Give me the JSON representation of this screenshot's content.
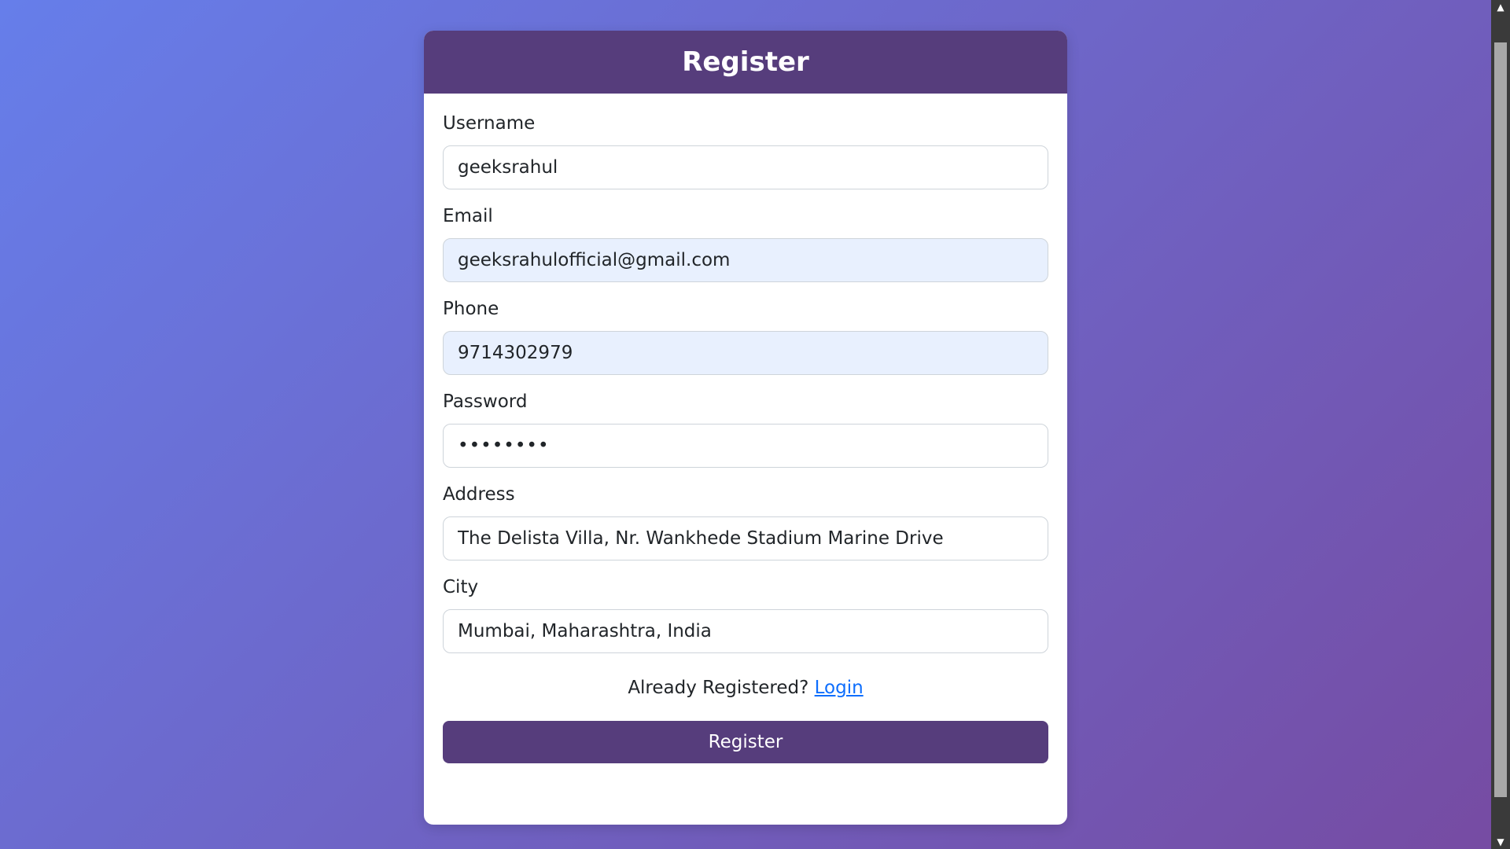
{
  "header": {
    "title": "Register"
  },
  "fields": [
    {
      "label": "Username",
      "value": "geeksrahul",
      "type": "text"
    },
    {
      "label": "Email",
      "value": "geeksrahulofficial@gmail.com",
      "type": "email"
    },
    {
      "label": "Phone",
      "value": "9714302979",
      "type": "tel"
    },
    {
      "label": "Password",
      "value": "••••••••",
      "type": "password"
    },
    {
      "label": "Address",
      "value": "The Delista Villa, Nr. Wankhede Stadium Marine Drive",
      "type": "text"
    },
    {
      "label": "City",
      "value": "Mumbai, Maharashtra, India",
      "type": "text"
    }
  ],
  "login_prompt": {
    "text": "Already Registered?",
    "link": "Login"
  },
  "submit_label": "Register",
  "icons": {
    "scroll_up": "triangle-up-icon",
    "scroll_down": "triangle-down-icon"
  },
  "colors": {
    "header_bg": "#563d7c",
    "button_bg": "#563d7c",
    "link": "#0d6efd",
    "autofill_bg": "#e8f0fe",
    "gradient_start": "#667eea",
    "gradient_end": "#764ba2"
  }
}
